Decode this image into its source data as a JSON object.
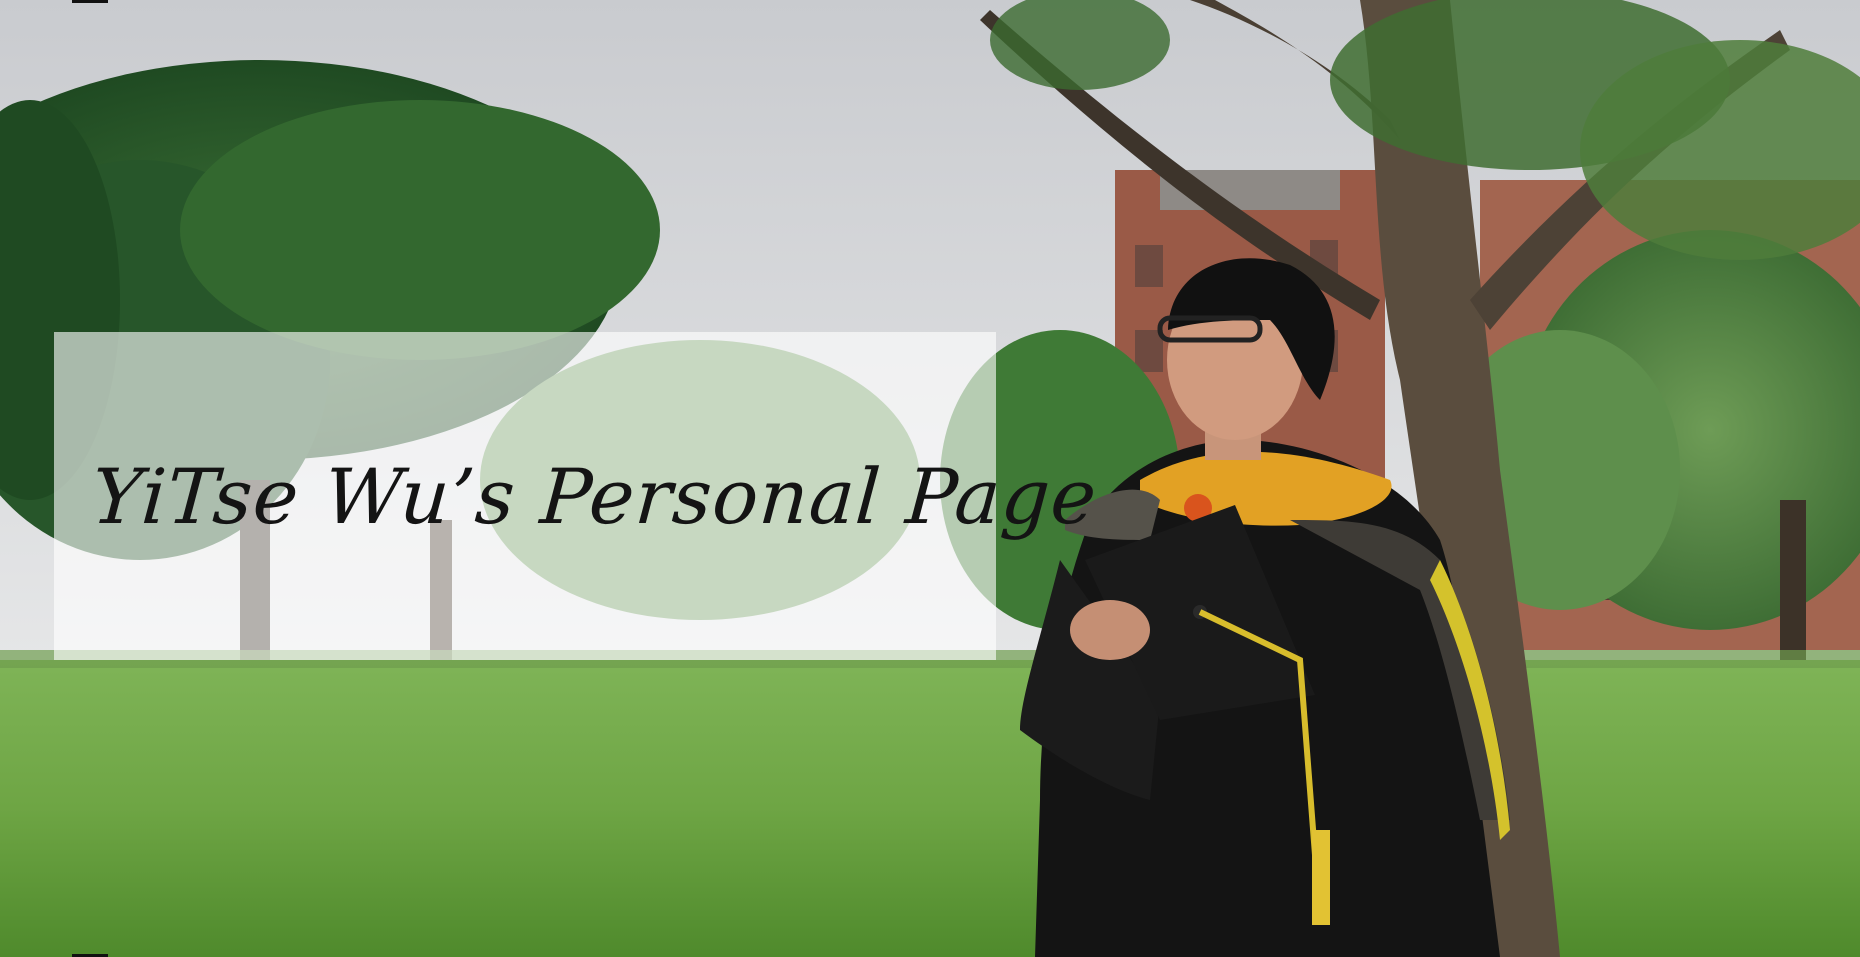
{
  "hero": {
    "title": "YiTse Wu’s Personal Page"
  }
}
